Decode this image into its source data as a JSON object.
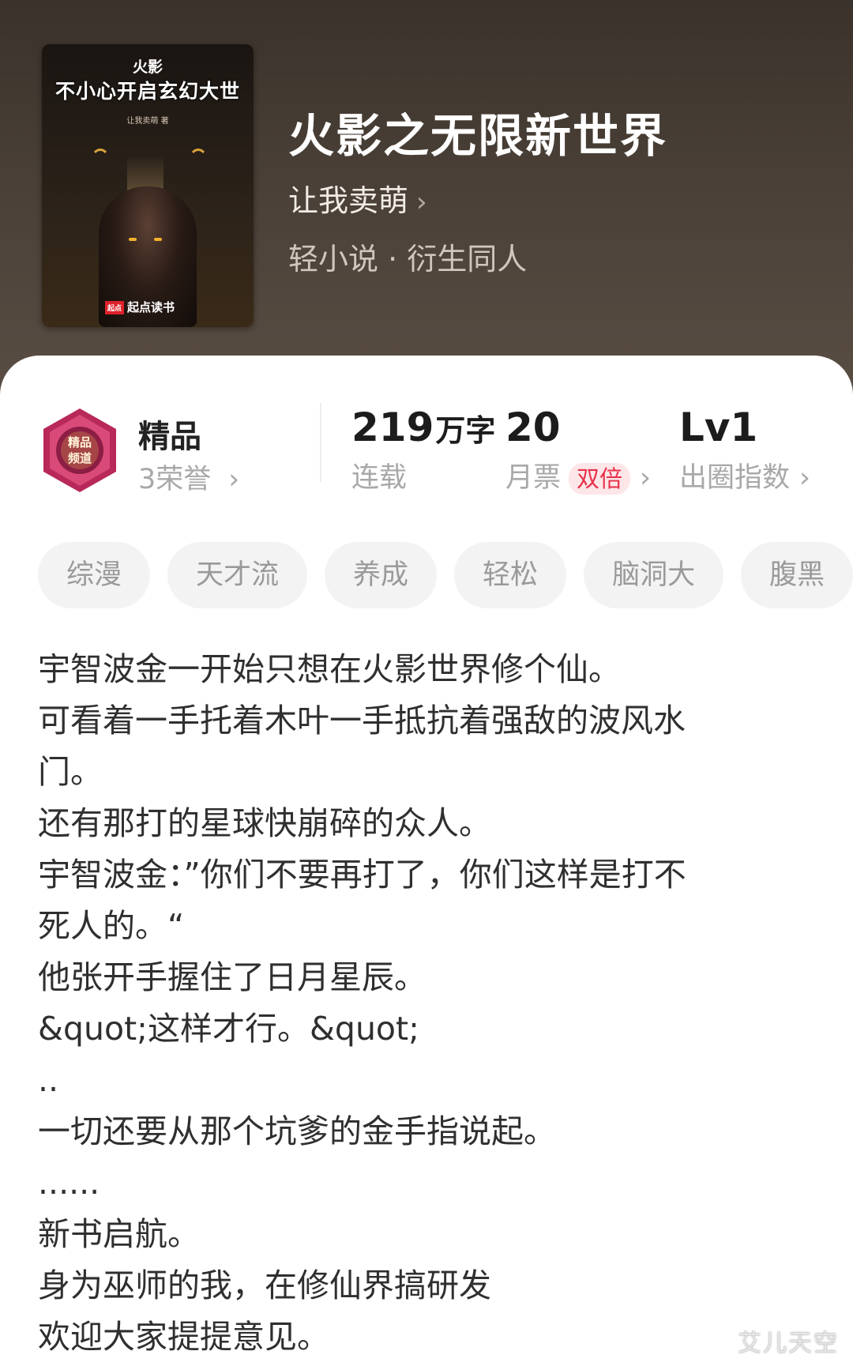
{
  "book": {
    "cover": {
      "line1": "火影",
      "line2": "不小心开启玄幻大世",
      "author_small": "让我卖萌 著",
      "publisher_badge": "起点",
      "publisher": "起点读书"
    },
    "title": "火影之无限新世界",
    "author": "让我卖萌",
    "category": "轻小说 · 衍生同人"
  },
  "stats": {
    "honor_title": "精品",
    "honor_sub": "3荣誉",
    "word_count": "219",
    "word_unit": "万字",
    "status": "连载",
    "monthly_tickets": "20",
    "monthly_label": "月票",
    "double_badge": "双倍",
    "level": "Lv1",
    "level_label": "出圈指数"
  },
  "tags": [
    "综漫",
    "天才流",
    "养成",
    "轻松",
    "脑洞大",
    "腹黑"
  ],
  "description": [
    "宇智波金一开始只想在火影世界修个仙。",
    "可看着一手托着木叶一手抵抗着强敌的波风水",
    "门。",
    "还有那打的星球快崩碎的众人。",
    "宇智波金：”你们不要再打了，你们这样是打不",
    "死人的。“",
    "他张开手握住了日月星辰。",
    "&quot;这样才行。&quot;",
    "..",
    "一切还要从那个坑爹的金手指说起。",
    "......",
    "新书启航。",
    "身为巫师的我，在修仙界搞研发",
    "欢迎大家提提意见。"
  ],
  "watermark": "艾儿天空",
  "colors": {
    "header_bg": "#3a322b",
    "accent_red": "#e8304a",
    "tag_bg": "#f3f3f3"
  }
}
